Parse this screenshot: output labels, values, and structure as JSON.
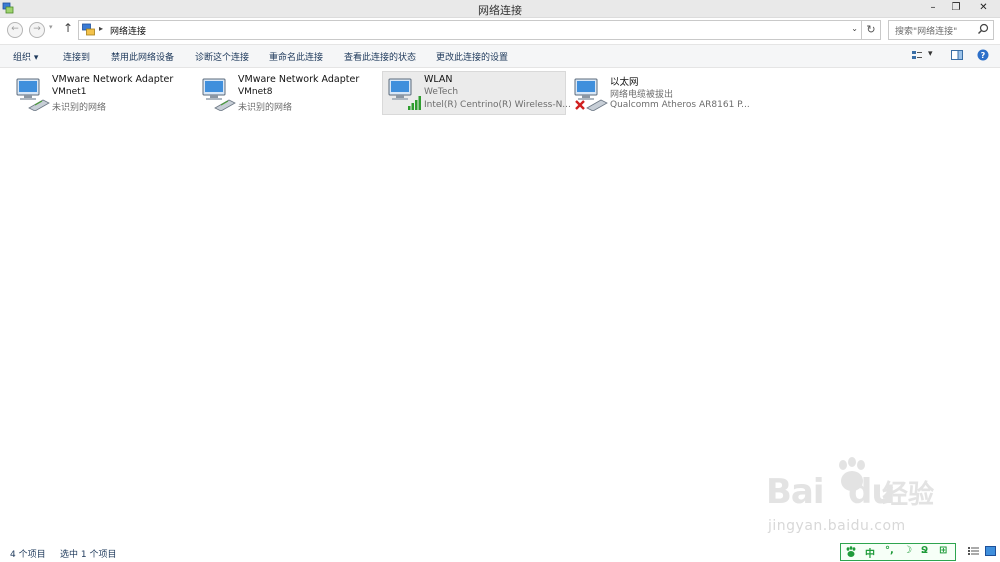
{
  "window": {
    "title": "网络连接",
    "controls": {
      "minimize": "–",
      "restore": "❐",
      "close": "✕"
    }
  },
  "address": {
    "crumb": "网络连接",
    "separator": "▸",
    "search_placeholder": "搜索\"网络连接\""
  },
  "nav": {
    "back": "←",
    "forward": "→",
    "recent": "▾",
    "up": "↑",
    "refresh": "↻",
    "dropdown": "⌄"
  },
  "toolbar": {
    "organize": "组织 ▾",
    "connect": "连接到",
    "disable": "禁用此网络设备",
    "diagnose": "诊断这个连接",
    "rename": "重命名此连接",
    "status": "查看此连接的状态",
    "settings": "更改此连接的设置",
    "view_menu": "▾"
  },
  "connections": [
    {
      "name": "VMware Network Adapter",
      "line2": "VMnet1",
      "line3": "未识别的网络",
      "state": "normal",
      "icon": "network-adapter-icon"
    },
    {
      "name": "VMware Network Adapter",
      "line2": "VMnet8",
      "line3": "未识别的网络",
      "state": "normal",
      "icon": "network-adapter-icon"
    },
    {
      "name": "WLAN",
      "line2": "WeTech",
      "line3": "Intel(R) Centrino(R) Wireless-N...",
      "state": "wireless-connected",
      "icon": "wireless-adapter-icon",
      "selected": true
    },
    {
      "name": "以太网",
      "line2": "网络电缆被拔出",
      "line3": "Qualcomm Atheros AR8161 P...",
      "state": "cable-unplugged",
      "icon": "ethernet-unplugged-icon"
    }
  ],
  "status": {
    "item_count": "4 个项目",
    "selected_count": "选中 1 个项目"
  },
  "ime": {
    "chars": [
      "中",
      "°,",
      "☽",
      "Ջ",
      "⊞"
    ]
  },
  "watermark": {
    "brand": "Bai",
    "brand2": "du",
    "product": "经验",
    "url": "jingyan.baidu.com"
  },
  "colors": {
    "accent": "#1e395b",
    "selection": "#ebebeb",
    "signal": "#2e9c2e",
    "error": "#d01f1f",
    "ime": "#1f9b3a"
  }
}
